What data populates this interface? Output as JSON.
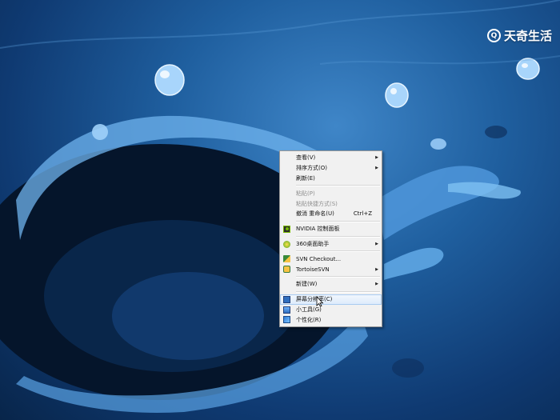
{
  "watermark": {
    "text": "天奇生活",
    "logo_letter": "Q"
  },
  "colors": {
    "desktop_blue": "#1f5f9f",
    "menu_bg": "#f1f1f1",
    "highlight": "#dcebfc"
  },
  "context_menu": {
    "items": [
      {
        "label": "查看(V)",
        "submenu": true
      },
      {
        "label": "排序方式(O)",
        "submenu": true
      },
      {
        "label": "刷新(E)"
      },
      {
        "separator": true
      },
      {
        "label": "粘贴(P)",
        "disabled": true
      },
      {
        "label": "粘贴快捷方式(S)",
        "disabled": true
      },
      {
        "label": "撤消 重命名(U)",
        "shortcut": "Ctrl+Z"
      },
      {
        "separator": true
      },
      {
        "label": "NVIDIA 控制面板",
        "icon": "nvidia-icon"
      },
      {
        "separator": true
      },
      {
        "label": "360桌面助手",
        "icon": "360-icon",
        "submenu": true
      },
      {
        "separator": true
      },
      {
        "label": "SVN Checkout...",
        "icon": "svn-checkout-icon"
      },
      {
        "label": "TortoiseSVN",
        "icon": "tortoisesvn-icon",
        "submenu": true
      },
      {
        "separator": true
      },
      {
        "label": "新建(W)",
        "submenu": true
      },
      {
        "separator": true
      },
      {
        "label": "屏幕分辨率(C)",
        "icon": "monitor-icon",
        "highlighted": true
      },
      {
        "label": "小工具(G)",
        "icon": "gadget-icon"
      },
      {
        "label": "个性化(R)",
        "icon": "personalize-icon"
      }
    ]
  }
}
